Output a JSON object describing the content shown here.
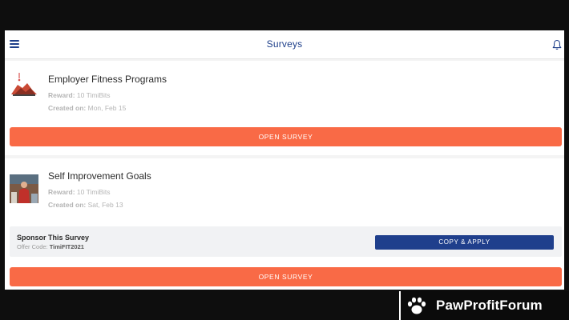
{
  "header": {
    "title": "Surveys",
    "menu_icon": "hamburger-menu-icon",
    "bell_icon": "bell-icon"
  },
  "colors": {
    "primary_blue": "#1e3f8a",
    "accent_orange": "#f96a46",
    "background": "#f4f4f4"
  },
  "surveys": [
    {
      "title": "Employer Fitness Programs",
      "reward_label": "Reward:",
      "reward_value": "10 TimiBits",
      "created_label": "Created on:",
      "created_value": "Mon, Feb 15",
      "button": "OPEN SURVEY"
    },
    {
      "title": "Self Improvement Goals",
      "reward_label": "Reward:",
      "reward_value": "10 TimiBits",
      "created_label": "Created on:",
      "created_value": "Sat, Feb 13",
      "button": "OPEN SURVEY",
      "sponsor": {
        "title": "Sponsor This Survey",
        "offer_label": "Offer Code:",
        "offer_code": "TimiFIT2021",
        "button": "COPY & APPLY"
      }
    }
  ],
  "watermark": {
    "text": "PawProfitForum",
    "icon": "paw-icon"
  }
}
